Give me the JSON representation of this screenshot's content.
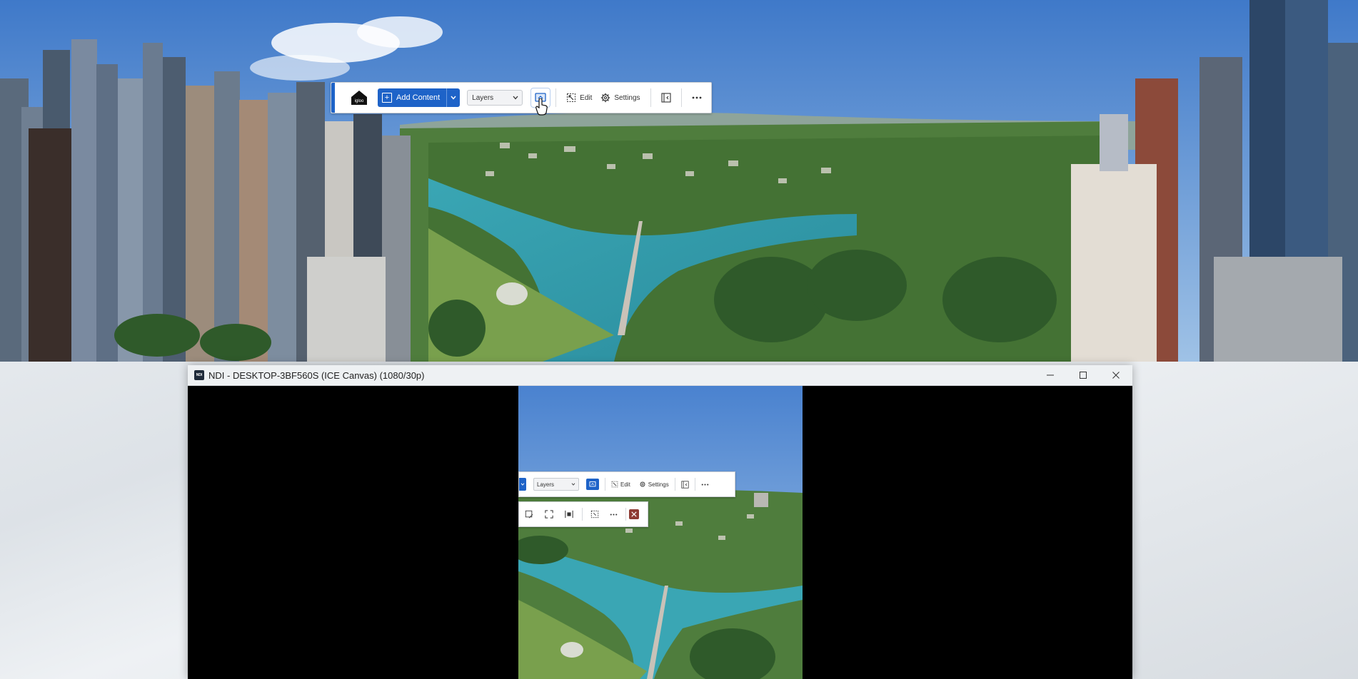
{
  "toolbar": {
    "logo_text": "igloo",
    "add_content_label": "Add Content",
    "layers_select": "Layers",
    "edit_label": "Edit",
    "settings_label": "Settings",
    "accent_color": "#1e63c8"
  },
  "ndi_window": {
    "title": "NDI - DESKTOP-3BF560S (ICE Canvas) (1080/30p)",
    "icon_text": "NDI"
  },
  "mirror_toolbar": {
    "layers_select": "Layers",
    "edit_label": "Edit",
    "settings_label": "Settings"
  },
  "icons": [
    "igloo-logo",
    "plus-icon",
    "chevron-down-icon",
    "screen-icon",
    "edit-icon",
    "gear-icon",
    "collapse-icon",
    "more-icon",
    "minimize-icon",
    "maximize-icon",
    "close-icon",
    "crop-icon",
    "fullscreen-icon",
    "fit-icon",
    "select-icon",
    "delete-icon"
  ]
}
